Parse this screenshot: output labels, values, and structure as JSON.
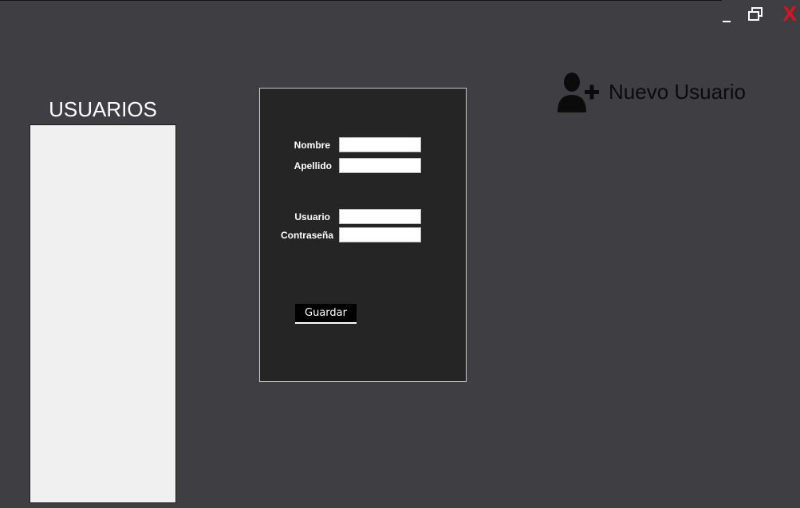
{
  "window": {
    "minimize_icon": "minimize-icon",
    "restore_icon": "restore-icon",
    "close_label": "X",
    "close_color": "#d7141f"
  },
  "users_panel": {
    "title": "USUARIOS",
    "items": []
  },
  "form": {
    "nombre_label": "Nombre",
    "nombre_value": "",
    "apellido_label": "Apellido",
    "apellido_value": "",
    "usuario_label": "Usuario",
    "usuario_value": "",
    "password_label": "Contraseña",
    "password_value": "",
    "save_label": "Guardar"
  },
  "new_user": {
    "icon": "add-user-icon",
    "label": "Nuevo Usuario"
  },
  "colors": {
    "background": "#3f3e43",
    "panel": "#252526",
    "list": "#f0f0f0",
    "accent_close": "#d7141f"
  }
}
